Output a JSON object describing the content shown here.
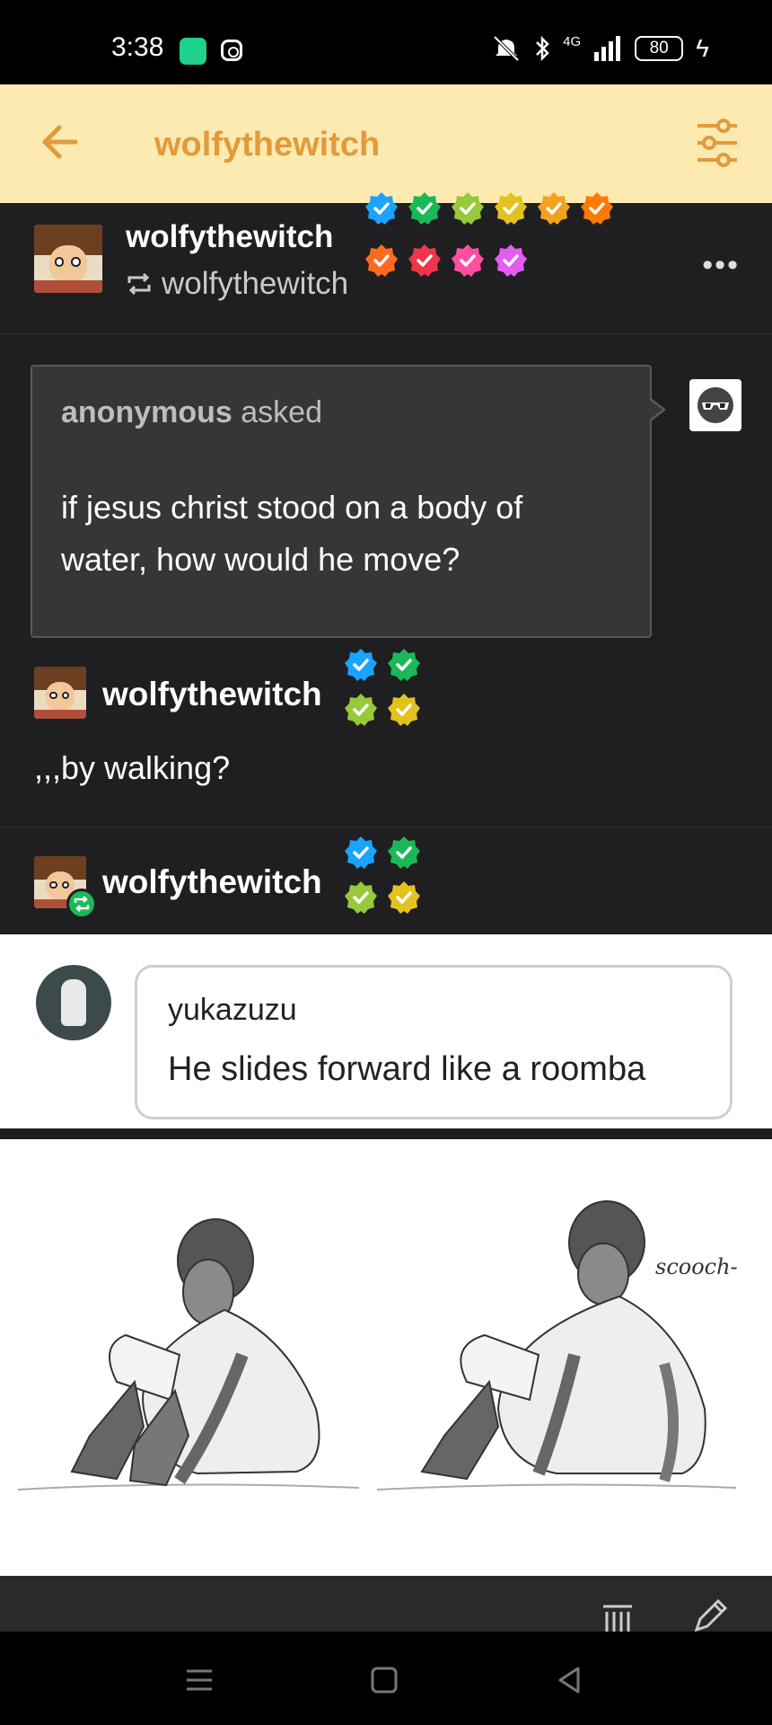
{
  "status_bar": {
    "time": "3:38",
    "network": "4G",
    "battery": "80",
    "icons": [
      "app-icon",
      "instagram-icon",
      "mute-icon",
      "bluetooth-icon",
      "signal-icon",
      "battery-icon",
      "charging-icon"
    ]
  },
  "header": {
    "title": "wolfythewitch",
    "back_icon": "arrow-left-icon",
    "filter_icon": "sliders-icon",
    "accent_color": "#e29a3a",
    "background": "#fdeab0"
  },
  "post": {
    "blog_name": "wolfythewitch",
    "reblogged_from": "wolfythewitch",
    "more_label": "•••",
    "badge_colors": [
      "#1aa3ff",
      "#19b959",
      "#98c93a",
      "#e2c31e",
      "#f2a21c",
      "#ff7a00",
      "#ff6b1e",
      "#f0354a",
      "#ff4fa0",
      "#e45cf2"
    ]
  },
  "ask": {
    "asker": "anonymous",
    "asked_label": "asked",
    "question": "if jesus christ stood on a body of water, how would he move?"
  },
  "reply": {
    "blog_name": "wolfythewitch",
    "text": ",,,by walking?"
  },
  "reblog2": {
    "blog_name": "wolfythewitch"
  },
  "comment": {
    "username": "yukazuzu",
    "text": "He slides forward like a roomba"
  },
  "drawing": {
    "annotation": "scooch-"
  },
  "nav": {
    "icons": [
      "menu-icon",
      "home-square-icon",
      "back-triangle-icon"
    ]
  }
}
